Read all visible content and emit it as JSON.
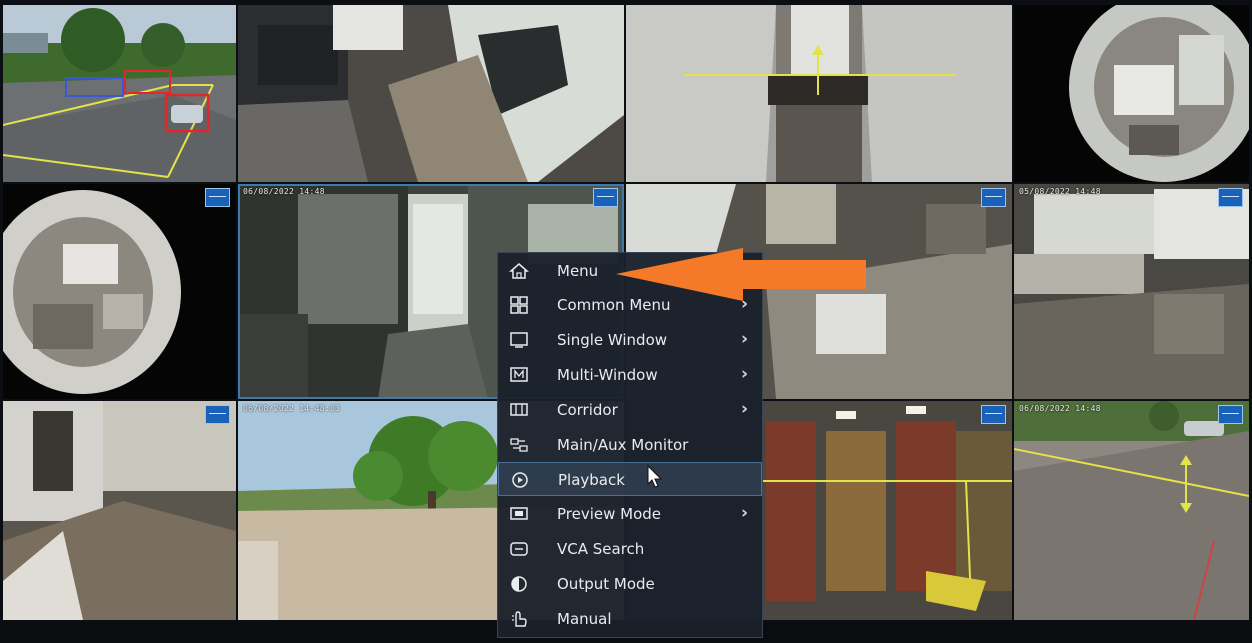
{
  "camera_grid": {
    "tiles": [
      {
        "id": "cam-1",
        "osd": ""
      },
      {
        "id": "cam-2",
        "osd": ""
      },
      {
        "id": "cam-3",
        "osd": ""
      },
      {
        "id": "cam-4",
        "osd": ""
      },
      {
        "id": "cam-5",
        "osd": ""
      },
      {
        "id": "cam-6",
        "osd": "06/08/2022 14:48"
      },
      {
        "id": "cam-7",
        "osd": ""
      },
      {
        "id": "cam-8",
        "osd": "05/08/2022 14:48"
      },
      {
        "id": "cam-9",
        "osd": ""
      },
      {
        "id": "cam-10",
        "osd": "06/08/2022 14:48:03"
      },
      {
        "id": "cam-11",
        "osd": ""
      },
      {
        "id": "cam-12",
        "osd": "06/08/2022 14:48"
      }
    ]
  },
  "context_menu": {
    "items": [
      {
        "label": "Menu",
        "icon": "home-icon",
        "has_submenu": false
      },
      {
        "label": "Common Menu",
        "icon": "grid-icon",
        "has_submenu": true
      },
      {
        "label": "Single Window",
        "icon": "single-window-icon",
        "has_submenu": true
      },
      {
        "label": "Multi-Window",
        "icon": "multi-window-icon",
        "has_submenu": true
      },
      {
        "label": "Corridor",
        "icon": "corridor-icon",
        "has_submenu": true
      },
      {
        "label": "Main/Aux Monitor",
        "icon": "monitor-switch-icon",
        "has_submenu": false
      },
      {
        "label": "Playback",
        "icon": "playback-icon",
        "has_submenu": false
      },
      {
        "label": "Preview Mode",
        "icon": "preview-mode-icon",
        "has_submenu": true
      },
      {
        "label": "VCA Search",
        "icon": "vca-search-icon",
        "has_submenu": false
      },
      {
        "label": "Output Mode",
        "icon": "output-mode-icon",
        "has_submenu": false
      },
      {
        "label": "Manual",
        "icon": "manual-icon",
        "has_submenu": false
      }
    ],
    "highlighted_item": "Playback",
    "chevron": "›"
  },
  "colors": {
    "annotation_arrow": "#f47a2a",
    "menu_background": "#1b212b",
    "active_tile_border": "#3f79a8",
    "vca_line": "#e4e24a",
    "detection_box": "#e0282b"
  }
}
